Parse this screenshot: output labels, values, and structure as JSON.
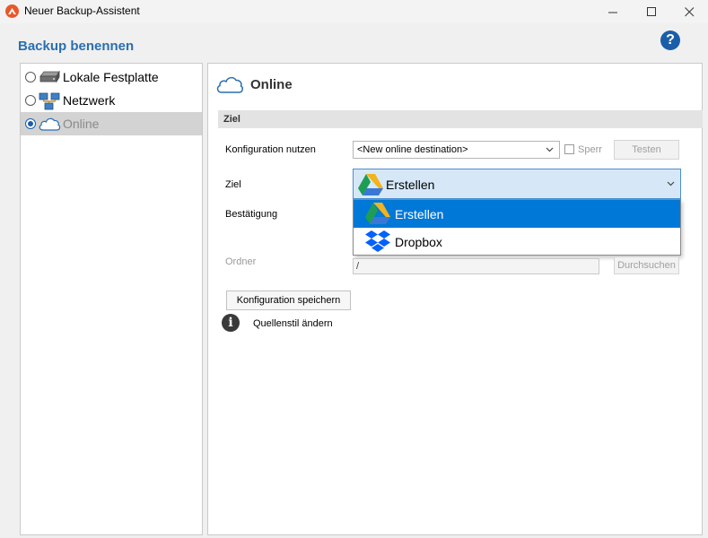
{
  "window": {
    "title": "Neuer Backup-Assistent",
    "controls": [
      "minimize",
      "maximize",
      "close"
    ]
  },
  "header": {
    "title": "Backup benennen",
    "help_icon": "help-icon"
  },
  "sidebar": {
    "items": [
      {
        "label": "Lokale Festplatte",
        "icon": "hard-drive-icon",
        "selected": false
      },
      {
        "label": "Netzwerk",
        "icon": "network-icon",
        "selected": false
      },
      {
        "label": "Online",
        "icon": "cloud-icon",
        "selected": true
      }
    ]
  },
  "main": {
    "heading": "Online",
    "section": "Ziel",
    "config": {
      "label": "Konfiguration nutzen",
      "value": "<New online destination>",
      "lock_label": "Sperr",
      "test_button": "Testen"
    },
    "ziel": {
      "label": "Ziel",
      "value": "Erstellen",
      "options": [
        {
          "label": "Erstellen",
          "icon": "google-drive-icon",
          "active": true
        },
        {
          "label": "Dropbox",
          "icon": "dropbox-icon",
          "active": false
        }
      ]
    },
    "confirmation_label": "Bestätigung",
    "folder": {
      "label": "Ordner",
      "value": "/",
      "browse_button": "Durchsuchen"
    },
    "save_button": "Konfiguration speichern",
    "info_text": "Quellenstil ändern"
  },
  "colors": {
    "accent": "#1a5ea8",
    "title_blue": "#2a6fb0",
    "dropdown_highlight": "#0078d7",
    "app_icon": "#e8582a"
  }
}
